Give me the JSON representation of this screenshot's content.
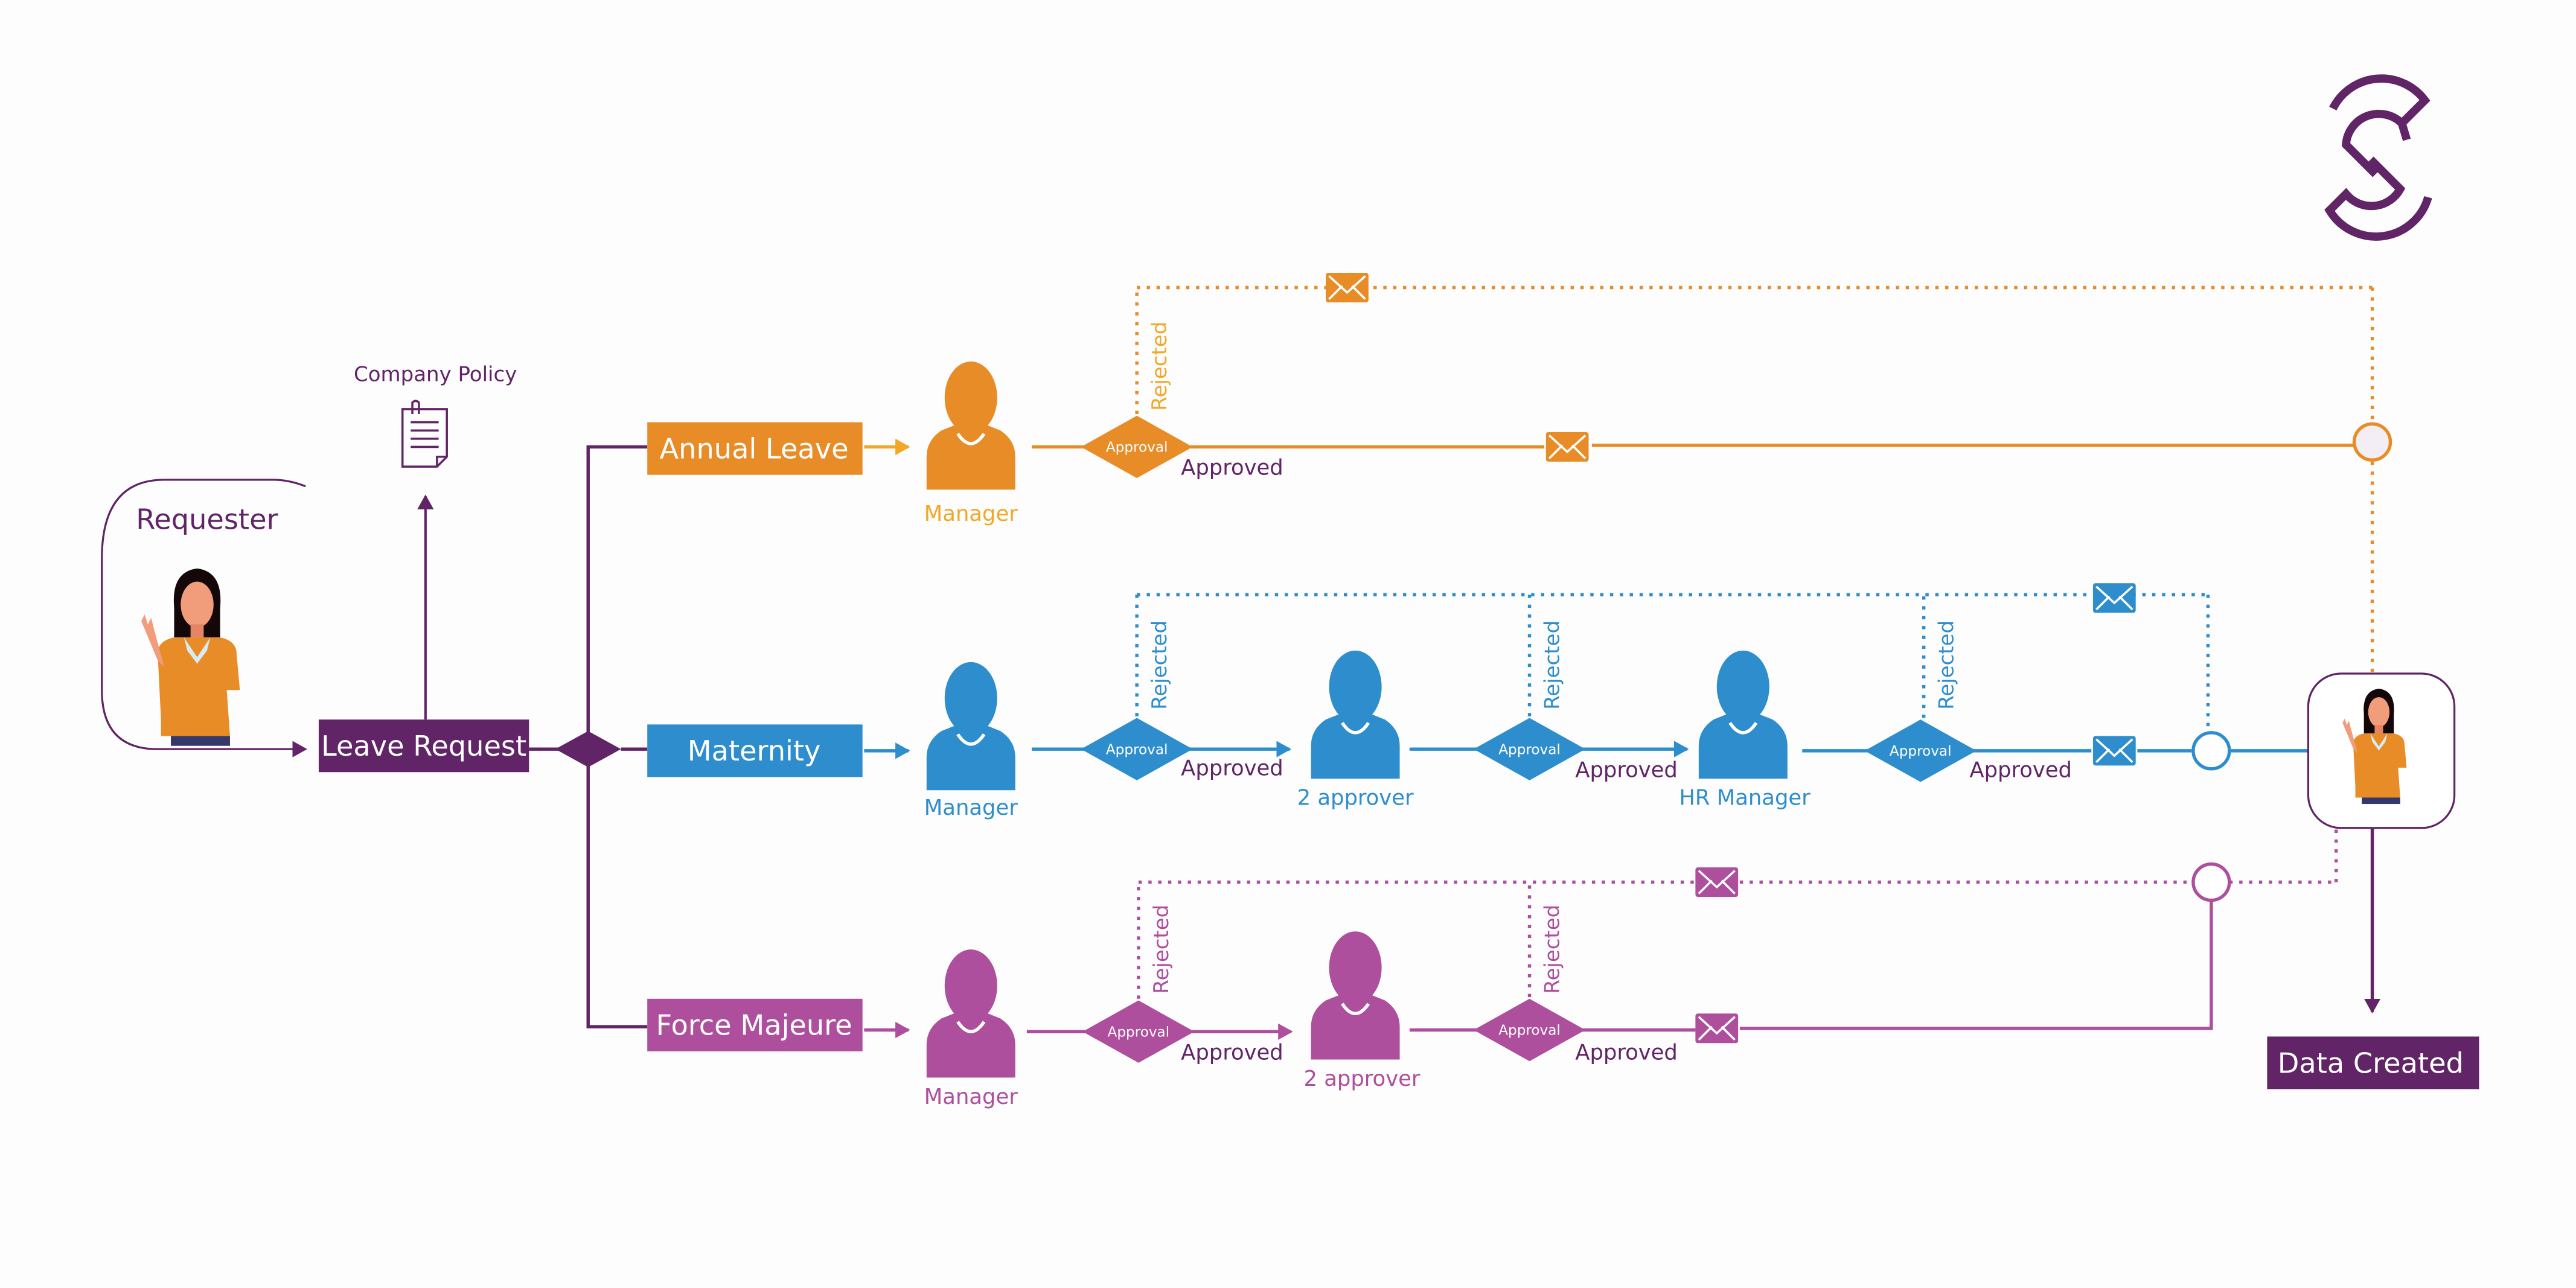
{
  "colors": {
    "purple": "#612466",
    "orange": "#e88c28",
    "orange_text": "#f2a726",
    "blue": "#2e8ecd",
    "magenta": "#ad4f9c",
    "white": "#ffffff"
  },
  "requester": {
    "label": "Requester"
  },
  "company_policy": {
    "label": "Company Policy"
  },
  "leave_request": {
    "label": "Leave Request"
  },
  "data_created": {
    "label": "Data Created"
  },
  "lanes": {
    "annual": {
      "label": "Annual Leave",
      "approvers": [
        "Manager"
      ],
      "gateway_label": "Approval",
      "approved_label": "Approved",
      "rejected_label": "Rejected"
    },
    "maternity": {
      "label": "Maternity",
      "approvers": [
        "Manager",
        "2 approver",
        "HR Manager"
      ],
      "gateway_label": "Approval",
      "approved_label": "Approved",
      "rejected_label": "Rejected"
    },
    "force": {
      "label": "Force Majeure",
      "approvers": [
        "Manager",
        "2 approver"
      ],
      "gateway_label": "Approval",
      "approved_label": "Approved",
      "rejected_label": "Rejected"
    }
  },
  "icons": {
    "logo": "company-s-logo",
    "document": "document-icon",
    "person": "person-icon",
    "envelope": "envelope-icon",
    "event": "event-circle"
  }
}
